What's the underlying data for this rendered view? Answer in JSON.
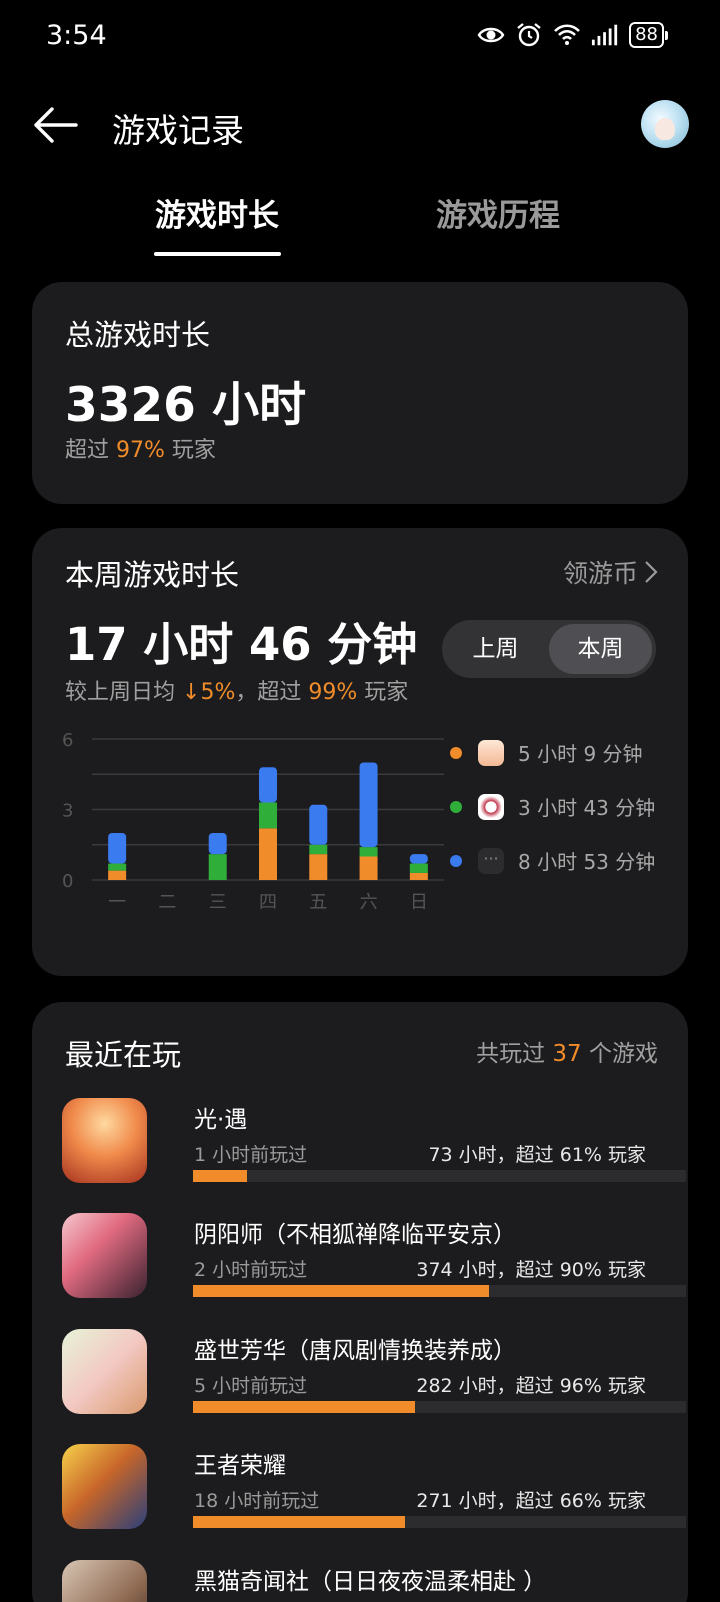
{
  "status_bar": {
    "time": "3:54",
    "battery": "88"
  },
  "header": {
    "title": "游戏记录"
  },
  "tabs": [
    {
      "label": "游戏时长",
      "active": true
    },
    {
      "label": "游戏历程",
      "active": false
    }
  ],
  "total": {
    "label": "总游戏时长",
    "value": "3326 小时",
    "exceed_prefix": "超过",
    "exceed_pct": "97%",
    "exceed_suffix": "玩家"
  },
  "week": {
    "label": "本周游戏时长",
    "coin_link": "领游币",
    "value": "17 小时 46 分钟",
    "compare_prefix": "较上周日均",
    "compare_change": "↓5%",
    "compare_sep": "，超过",
    "compare_pct": "99%",
    "compare_suffix": "玩家",
    "toggle": {
      "last_week": "上周",
      "this_week": "本周",
      "selected": "本周"
    },
    "legend": [
      {
        "color": "#f08c2a",
        "icon": "sky-game-icon",
        "text": "5 小时 9 分钟"
      },
      {
        "color": "#2fae3a",
        "icon": "onmyoji-game-icon",
        "text": "3 小时 43 分钟"
      },
      {
        "color": "#3a7bf0",
        "icon": "more-icon",
        "text": "8 小时 53 分钟"
      }
    ]
  },
  "chart_data": {
    "type": "bar",
    "stacked": true,
    "categories": [
      "一",
      "二",
      "三",
      "四",
      "五",
      "六",
      "日"
    ],
    "yticks": [
      "6",
      "3",
      "0"
    ],
    "ylim": [
      0,
      6
    ],
    "grid": true,
    "series": [
      {
        "color": "#f08c2a",
        "values": [
          0.4,
          0,
          0,
          2.2,
          1.1,
          1.0,
          0.3
        ]
      },
      {
        "color": "#2fae3a",
        "values": [
          0.3,
          0,
          1.1,
          1.1,
          0.4,
          0.4,
          0.4
        ]
      },
      {
        "color": "#3a7bf0",
        "values": [
          1.3,
          0,
          0.9,
          1.5,
          1.7,
          3.6,
          0.4
        ]
      }
    ]
  },
  "recent": {
    "label": "最近在玩",
    "count_prefix": "共玩过",
    "count": "37",
    "count_suffix": "个游戏",
    "games": [
      {
        "name": "光·遇",
        "last": "1 小时前玩过",
        "stat": "73 小时，超过 61% 玩家",
        "progress": 0.11,
        "icon": "sky-game-icon"
      },
      {
        "name": "阴阳师（不相狐禅降临平安京）",
        "last": "2 小时前玩过",
        "stat": "374 小时，超过 90% 玩家",
        "progress": 0.6,
        "icon": "onmyoji-game-icon"
      },
      {
        "name": "盛世芳华（唐风剧情换装养成）",
        "last": "5 小时前玩过",
        "stat": "282 小时，超过 96% 玩家",
        "progress": 0.45,
        "icon": "shengshi-game-icon"
      },
      {
        "name": "王者荣耀",
        "last": "18 小时前玩过",
        "stat": "271 小时，超过 66% 玩家",
        "progress": 0.43,
        "icon": "honor-of-kings-icon"
      },
      {
        "name": "黑猫奇闻社（日日夜夜温柔相赴 ）",
        "last": "",
        "stat": "",
        "progress": 0,
        "icon": "black-cat-game-icon"
      }
    ]
  }
}
